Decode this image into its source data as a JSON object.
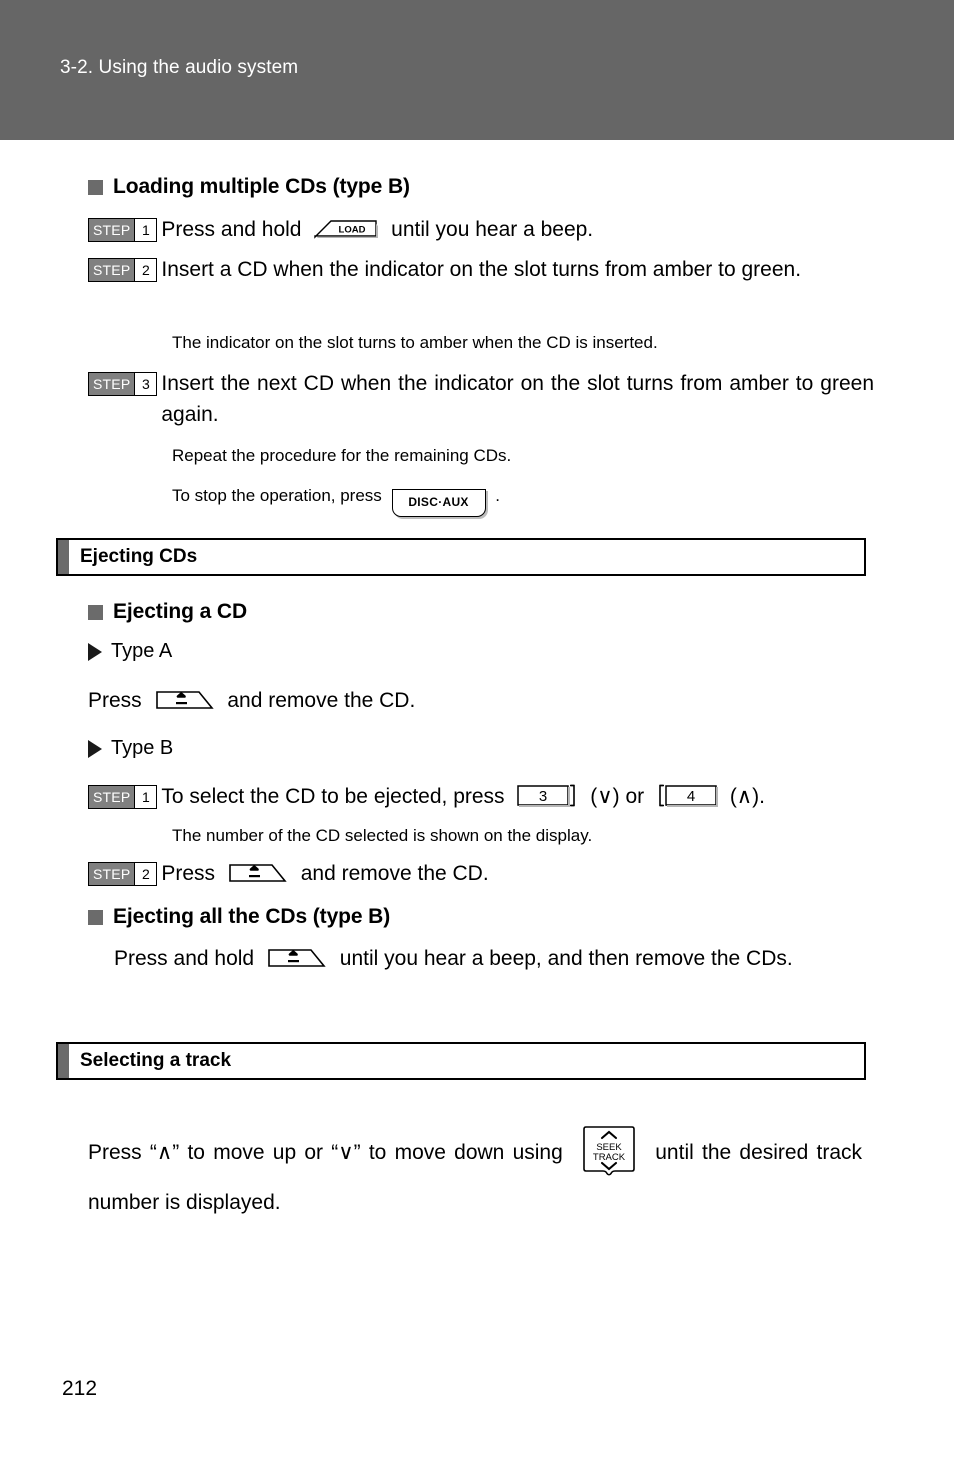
{
  "header": {
    "title": "3-2. Using the audio system"
  },
  "colors": {
    "header_band": "#666666",
    "step_badge": "#808080",
    "bullet_gray": "#6b6b6b",
    "text": "#000000",
    "page_background": "#ffffff"
  },
  "icons": {
    "load_button_label": "LOAD",
    "disc_aux_button_label": "DISC·AUX",
    "eject_button_label": "eject-triangle",
    "seek_track_label_line1": "SEEK",
    "seek_track_label_line2": "TRACK",
    "seek_up_glyph": "∧",
    "seek_down_glyph": "∨",
    "disc_button_3_label": "3",
    "disc_button_4_label": "4"
  },
  "loading_section": {
    "heading": "Loading multiple CDs (type B)",
    "steps": [
      {
        "step_word": "STEP",
        "number": "1",
        "text_before": "Press and hold",
        "button": "LOAD",
        "text_after": "until you hear a beep."
      },
      {
        "step_word": "STEP",
        "number": "2",
        "text": "Insert a CD when the indicator on the slot turns from amber to green.",
        "note": "The indicator on the slot turns to amber when the CD is inserted."
      },
      {
        "step_word": "STEP",
        "number": "3",
        "text": "Insert the next CD when the indicator on the slot turns from amber to green again.",
        "note": "Repeat the procedure for the remaining CDs.",
        "note2_before": "To stop the operation, press",
        "note2_button": "DISC·AUX",
        "note2_after": "."
      }
    ]
  },
  "ejecting_section": {
    "bar_title": "Ejecting CDs",
    "subheading_1": "Ejecting a CD",
    "type_a": {
      "label": "Type A",
      "text_before": "Press",
      "text_after": "and remove the CD."
    },
    "type_b": {
      "label": "Type B",
      "steps": [
        {
          "step_word": "STEP",
          "number": "1",
          "text_before": "To select the CD to be ejected, press",
          "button_1": "3",
          "mid_1": "(∨) or",
          "button_2": "4",
          "mid_2": "(∧).",
          "note": "The number of the CD selected is shown on the display."
        },
        {
          "step_word": "STEP",
          "number": "2",
          "text_before": "Press",
          "text_after": "and remove the CD."
        }
      ]
    },
    "subheading_2": "Ejecting all the CDs (type B)",
    "all_cds": {
      "text_before": "Press and hold",
      "text_after": "until you hear a beep, and then remove the CDs."
    }
  },
  "selecting_section": {
    "bar_title": "Selecting a track",
    "text_before": "Press “∧” to move up or “∨” to move down using",
    "text_after": "until the desired track number is displayed."
  },
  "footer": {
    "page_number": "212"
  }
}
